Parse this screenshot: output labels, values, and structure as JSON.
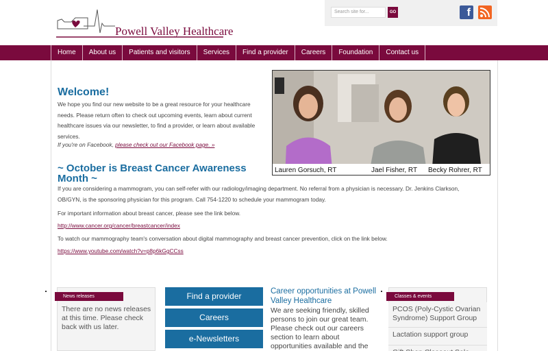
{
  "header": {
    "logo_text": "Powell Valley Healthcare",
    "search_placeholder": "Search site for...",
    "search_button": "GO",
    "facebook_glyph": "f"
  },
  "nav": {
    "items": [
      {
        "label": "Home"
      },
      {
        "label": "About us"
      },
      {
        "label": "Patients and visitors"
      },
      {
        "label": "Services"
      },
      {
        "label": "Find a provider"
      },
      {
        "label": "Careers"
      },
      {
        "label": "Foundation"
      },
      {
        "label": "Contact us"
      }
    ]
  },
  "welcome": {
    "title": "Welcome!",
    "body": "We hope you find our new website to be a great resource for your healthcare needs. Please return often to check out upcoming events, learn about current healthcare issues via our newsletter, to find a provider, or learn about available services.",
    "fb_prefix": "If you're on Facebook, ",
    "fb_link": "please check out our Facebook page. »"
  },
  "photo": {
    "captions": [
      "Lauren Gorsuch, RT",
      "Jael Fisher, RT",
      "Becky Rohrer, RT"
    ]
  },
  "october": {
    "title": "~ October is Breast Cancer Awareness Month ~",
    "p1": "If you are considering a mammogram, you can self-refer with our radiology/imaging department.  No referral from a physician is necessary.  Dr. Jenkins Clarkson, OB/GYN, is the sponsoring physician for this program.  Call 754-1220 to schedule your mammogram today.",
    "p2": "For important information about breast cancer, please see the link below.",
    "link1": "http://www.cancer.org/cancer/breastcancer/index",
    "p3": "To watch our mammography team's conversation about digital mammography and breast cancer prevention, click on the link below.",
    "link2": "https://www.youtube.com/watch?v=p8p6kGgCCss"
  },
  "news": {
    "tab": "News releases",
    "text": "There are no news releases at this time. Please check back with us later."
  },
  "buttons": [
    "Find a provider",
    "Careers",
    "e-Newsletters"
  ],
  "careers": {
    "title": "Career opportunities at Powell Valley Healthcare",
    "body": "We are seeking friendly, skilled persons to join our great team. Please check out our careers section to learn about opportunities available and the"
  },
  "classes": {
    "tab": "Classes & events",
    "items": [
      "PCOS (Poly-Cystic Ovarian Syndrome) Support Group",
      "Lactation support group",
      "Gift Shop Closeout Sale"
    ]
  },
  "colors": {
    "brand_maroon": "#7a0a3d",
    "heading_blue": "#1a6da0",
    "facebook_blue": "#3b5998",
    "rss_orange": "#f26522"
  },
  "icons": [
    "heart-logo-icon",
    "search-icon",
    "facebook-icon",
    "rss-icon"
  ]
}
